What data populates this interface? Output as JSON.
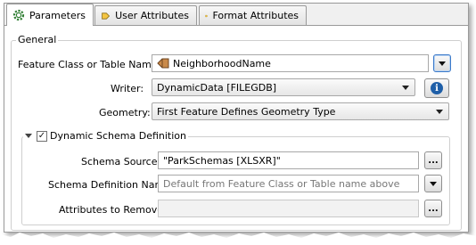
{
  "tabs": [
    {
      "label": "Parameters",
      "icon": "gear-icon",
      "active": true
    },
    {
      "label": "User Attributes",
      "icon": "attribute-tag-icon",
      "active": false
    },
    {
      "label": "Format Attributes",
      "icon": "attribute-tag-icon",
      "active": false
    }
  ],
  "general": {
    "title": "General",
    "feature_class_label": "Feature Class or Table Name:",
    "feature_class_value": "NeighborhoodName",
    "writer_label": "Writer:",
    "writer_value": "DynamicData [FILEGDB]",
    "geometry_label": "Geometry:",
    "geometry_value": "First Feature Defines Geometry Type"
  },
  "dynamic_schema": {
    "title": "Dynamic Schema Definition",
    "checked": true,
    "schema_sources_label": "Schema Sources:",
    "schema_sources_value": "\"ParkSchemas [XLSXR]\"",
    "schema_definition_name_label": "Schema Definition Name:",
    "schema_definition_name_placeholder": "Default from Feature Class or Table name above",
    "attributes_to_remove_label": "Attributes to Remove:",
    "attributes_to_remove_value": ""
  },
  "buttons": {
    "ellipsis_label": "..."
  },
  "colors": {
    "info_blue": "#1f5fa8",
    "focus_blue": "#3b79c9",
    "panel_bg": "#ffffff",
    "chrome_bg": "#f0f0f0"
  }
}
